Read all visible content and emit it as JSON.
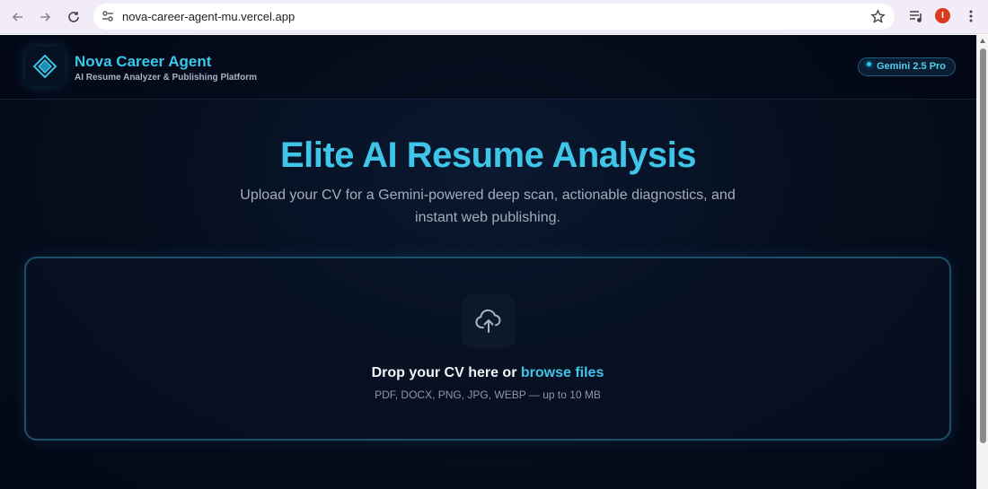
{
  "browser": {
    "url": "nova-career-agent-mu.vercel.app",
    "profile_initial": "I"
  },
  "header": {
    "title": "Nova Career Agent",
    "subtitle": "AI Resume Analyzer & Publishing Platform",
    "model_badge": "Gemini 2.5 Pro"
  },
  "hero": {
    "title": "Elite AI Resume Analysis",
    "subtitle": "Upload your CV for a Gemini-powered deep scan, actionable diagnostics, and instant web publishing."
  },
  "dropzone": {
    "prompt": "Drop your CV here or ",
    "browse_label": "browse files",
    "formats": "PDF, DOCX, PNG, JPG, WEBP — up to 10 MB"
  },
  "colors": {
    "accent": "#3fc5e8",
    "background": "#050c1b",
    "profile": "#d93a1f"
  },
  "icons": [
    "back-arrow-icon",
    "forward-arrow-icon",
    "reload-icon",
    "site-info-icon",
    "star-icon",
    "media-control-icon",
    "more-menu-icon",
    "diamond-logo-icon",
    "cloud-upload-icon"
  ]
}
